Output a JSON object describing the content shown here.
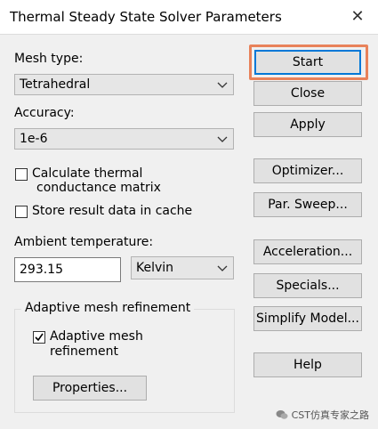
{
  "window": {
    "title": "Thermal Steady State Solver Parameters",
    "close_glyph": "✕"
  },
  "mesh_type": {
    "label": "Mesh type:",
    "value": "Tetrahedral"
  },
  "accuracy": {
    "label": "Accuracy:",
    "value": "1e-6"
  },
  "options": {
    "calc_thermal_line1": "Calculate thermal",
    "calc_thermal_line2": "conductance matrix",
    "calc_thermal_checked": false,
    "store_result": "Store result data in cache",
    "store_result_checked": false
  },
  "ambient": {
    "label": "Ambient temperature:",
    "value": "293.15",
    "unit": "Kelvin"
  },
  "adaptive": {
    "group_title": "Adaptive mesh refinement",
    "check_line1": "Adaptive mesh",
    "check_line2": "refinement",
    "checked": true,
    "properties_button": "Properties..."
  },
  "buttons": {
    "start": "Start",
    "close": "Close",
    "apply": "Apply",
    "optimizer": "Optimizer...",
    "par_sweep": "Par. Sweep...",
    "acceleration": "Acceleration...",
    "specials": "Specials...",
    "simplify_model": "Simplify Model...",
    "help": "Help"
  },
  "watermark": {
    "text": "CST仿真专家之路",
    "icon": "wechat-icon"
  },
  "colors": {
    "highlight": "#e8825a",
    "default_button_border": "#0078d7"
  }
}
